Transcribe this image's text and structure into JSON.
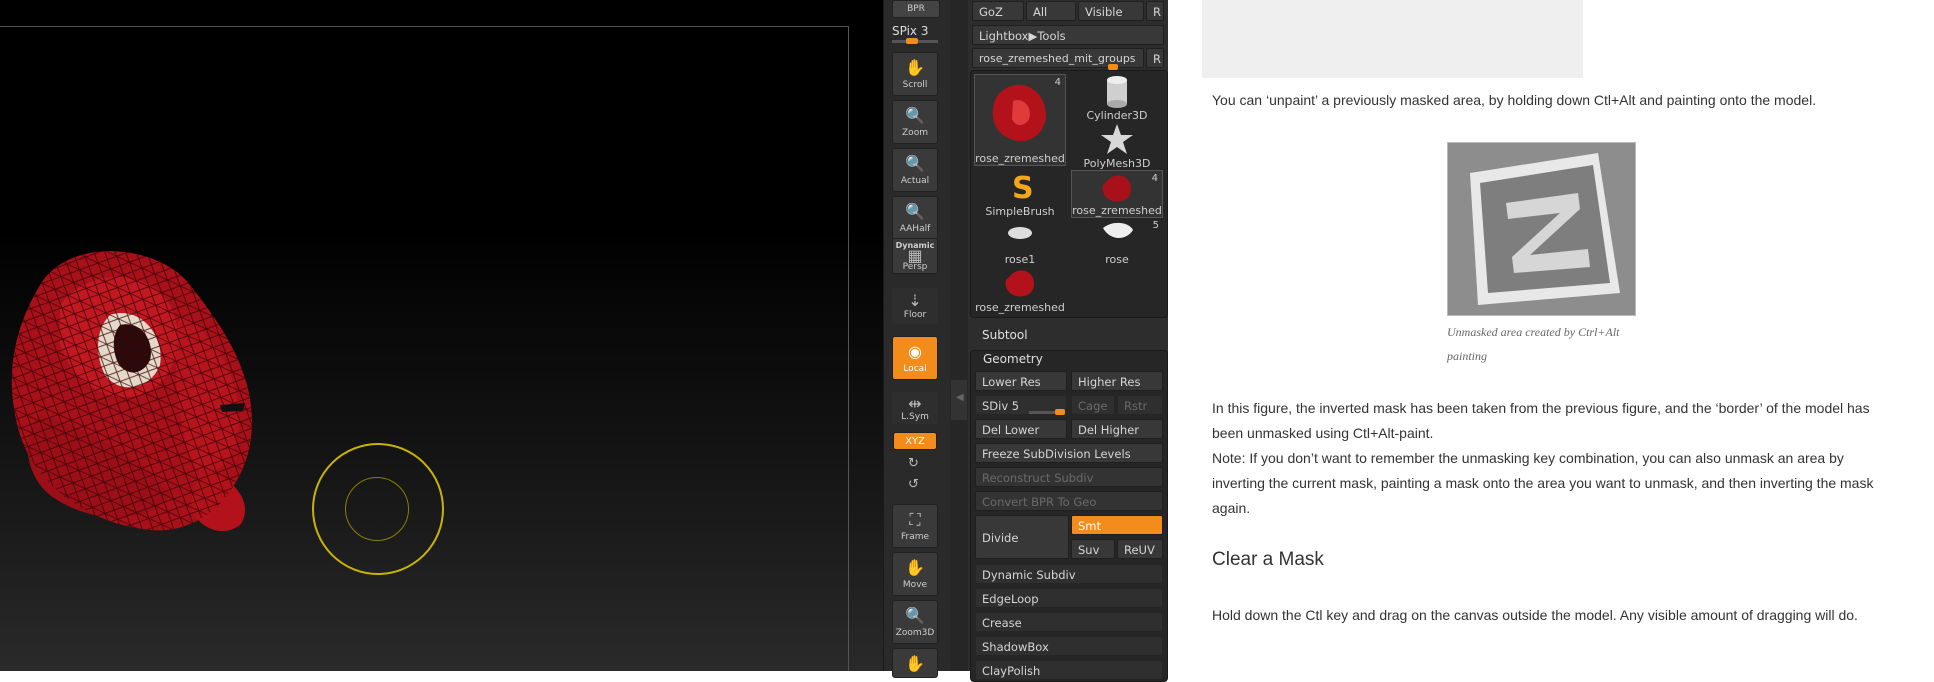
{
  "shelf": {
    "bpr_label": "BPR",
    "spix_label": "SPix 3",
    "spix_value": 0.4,
    "buttons": [
      "Scroll",
      "Zoom",
      "Actual",
      "AAHalf",
      "Persp",
      "Floor",
      "Local",
      "L.Sym",
      "XYZ",
      "Frame",
      "Move",
      "Zoom3D"
    ],
    "persp_top_label": "Dynamic"
  },
  "palette": {
    "top_buttons": [
      "GoZ",
      "All",
      "Visible",
      "R"
    ],
    "lightbox_tools": "Lightbox▶Tools",
    "current_tool": "rose_zremeshed_mit_groups",
    "current_tool_r": "R",
    "thumbs": [
      {
        "label": "rose_zremeshed",
        "count": "4"
      },
      {
        "label": "Cylinder3D",
        "count": ""
      },
      {
        "label": "PolyMesh3D",
        "count": ""
      },
      {
        "label": "SimpleBrush",
        "count": ""
      },
      {
        "label": "rose_zremeshed",
        "count": "4"
      },
      {
        "label": "rose1",
        "count": ""
      },
      {
        "label": "rose",
        "count": "5"
      },
      {
        "label": "rose_zremeshed",
        "count": ""
      }
    ],
    "subtool_label": "Subtool",
    "geometry_label": "Geometry",
    "lower_res": "Lower Res",
    "higher_res": "Higher Res",
    "sdiv_label": "SDiv 5",
    "sdiv_value": 1.0,
    "cage": "Cage",
    "rstr": "Rstr",
    "del_lower": "Del Lower",
    "del_higher": "Del Higher",
    "freeze": "Freeze SubDivision Levels",
    "reconstruct": "Reconstruct Subdiv",
    "convert_bpr": "Convert BPR To Geo",
    "divide": "Divide",
    "smt": "Smt",
    "suv": "Suv",
    "reuv": "ReUV",
    "dynamic_subdiv": "Dynamic Subdiv",
    "edgeloop": "EdgeLoop",
    "crease": "Crease",
    "shadowbox": "ShadowBox",
    "claypolish": "ClayPolish"
  },
  "doc": {
    "para1": "You can ‘unpaint’ a previously masked area, by holding down Ctl+Alt and painting onto the model.",
    "caption": "Unmasked area created by Ctrl+Alt painting",
    "para2": "In this figure, the inverted mask has been taken from the previous figure, and the ‘border’ of the model has been unmasked using Ctl+Alt-paint.",
    "para3": "Note: If you don’t want to remember the unmasking key combination, you can also unmask an area by inverting the current mask, painting a mask onto the area you want to unmask, and then inverting the mask again.",
    "heading": "Clear a Mask",
    "para4": "Hold down the Ctl key and drag on the canvas outside the model. Any visible amount of dragging will do."
  },
  "colors": {
    "accent": "#f28c1a",
    "rose": "#b3121b",
    "brush_ring": "#c8b400"
  }
}
